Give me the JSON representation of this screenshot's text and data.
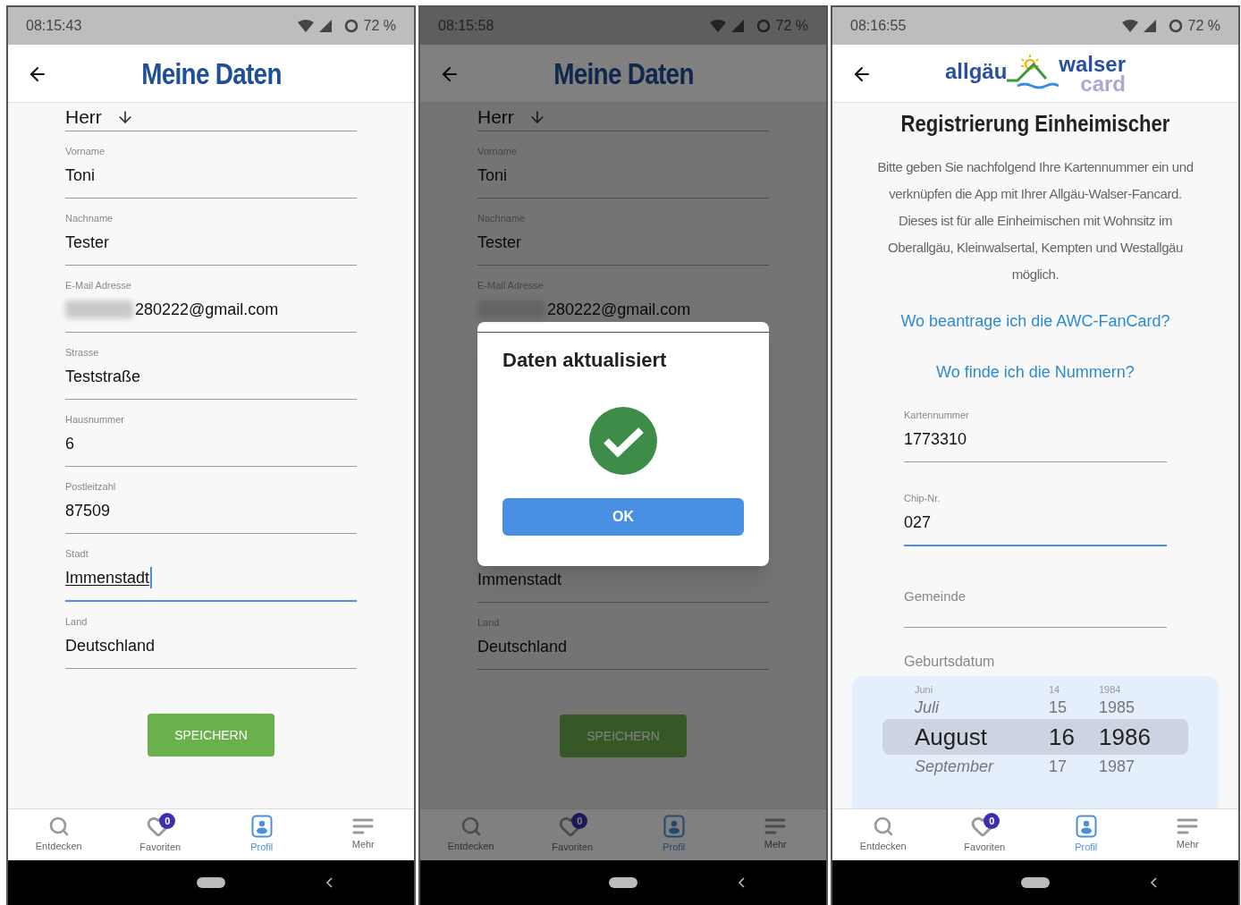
{
  "screens": [
    {
      "kind": "profile_form",
      "dimmed": false,
      "status_bar": {
        "time": "08:15:43",
        "battery": "72 %"
      },
      "header": {
        "kind": "title",
        "title": "Meine Daten"
      },
      "salutation": "Herr",
      "fields": [
        {
          "label": "Vorname",
          "value": "Toni",
          "focused": false,
          "redacted": false
        },
        {
          "label": "Nachname",
          "value": "Tester",
          "focused": false,
          "redacted": false
        },
        {
          "label": "E-Mail Adresse",
          "value": "280222@gmail.com",
          "focused": false,
          "redacted": true
        },
        {
          "label": "Strasse",
          "value": "Teststraße",
          "focused": false,
          "redacted": false
        },
        {
          "label": "Hausnummer",
          "value": "6",
          "focused": false,
          "redacted": false
        },
        {
          "label": "Postleitzahl",
          "value": "87509",
          "focused": false,
          "redacted": false
        },
        {
          "label": "Stadt",
          "value": "Immenstadt",
          "focused": true,
          "redacted": false
        },
        {
          "label": "Land",
          "value": "Deutschland",
          "focused": false,
          "redacted": false
        }
      ],
      "save_button": "SPEICHERN",
      "tabs": [
        {
          "kind": "search",
          "label": "Entdecken",
          "selected": false
        },
        {
          "kind": "heart",
          "label": "Favoriten",
          "badge": "0",
          "selected": false
        },
        {
          "kind": "profile",
          "label": "Profil",
          "selected": true
        },
        {
          "kind": "menu",
          "label": "Mehr",
          "selected": false
        }
      ]
    },
    {
      "kind": "profile_form",
      "dimmed": true,
      "status_bar": {
        "time": "08:15:58",
        "battery": "72 %"
      },
      "header": {
        "kind": "title",
        "title": "Meine Daten"
      },
      "salutation": "Herr",
      "fields": [
        {
          "kind": "field",
          "label": "Vorname",
          "value": "Toni",
          "focused": false,
          "redacted": false
        },
        {
          "kind": "field",
          "label": "Nachname",
          "value": "Tester",
          "focused": false,
          "redacted": false
        },
        {
          "kind": "field",
          "label": "E-Mail Adresse",
          "value": "280222@gmail.com",
          "focused": false,
          "redacted": true
        },
        {
          "kind": "dialog",
          "title": "Daten aktualisiert",
          "button": "OK"
        },
        {
          "kind": "field",
          "value": "Immenstadt",
          "focused": false,
          "redacted": false
        },
        {
          "kind": "field",
          "label": "Land",
          "value": "Deutschland",
          "focused": false,
          "redacted": false
        }
      ],
      "save_button": "SPEICHERN",
      "tabs": [
        {
          "kind": "search",
          "label": "Entdecken",
          "selected": false
        },
        {
          "kind": "heart",
          "label": "Favoriten",
          "badge": "0",
          "selected": false
        },
        {
          "kind": "profile",
          "label": "Profil",
          "selected": true
        },
        {
          "kind": "menu",
          "label": "Mehr",
          "selected": false
        }
      ]
    },
    {
      "kind": "registration",
      "dimmed": false,
      "status_bar": {
        "time": "08:16:55",
        "battery": "72 %"
      },
      "header": {
        "kind": "logo",
        "logo_words": [
          "allgäu",
          "walser",
          "card"
        ]
      },
      "heading": "Registrierung Einheimischer",
      "intro": "Bitte geben Sie nachfolgend Ihre Kartennummer ein und verknüpfen die App mit Ihrer Allgäu-Walser-Fancard. Dieses ist für alle Einheimischen mit Wohnsitz im Oberallgäu, Kleinwalsertal, Kempten und Westallgäu möglich.",
      "links": [
        "Wo beantrage ich die AWC-FanCard?",
        "Wo finde ich die Nummern?"
      ],
      "fields": [
        {
          "label": "Kartennummer",
          "value": "1773310",
          "focused": false,
          "redacted": false
        },
        {
          "label": "Chip-Nr.",
          "value": "027",
          "focused": true,
          "redacted": false
        },
        {
          "placeholder": "Gemeinde",
          "focused": false
        }
      ],
      "birthdate_label": "Geburtsdatum",
      "date_picker": [
        {
          "month": "Juni",
          "day": "14",
          "year": "1984",
          "selected": false
        },
        {
          "month": "Juli",
          "day": "15",
          "year": "1985",
          "selected": false
        },
        {
          "month": "August",
          "day": "16",
          "year": "1986",
          "selected": true
        },
        {
          "month": "September",
          "day": "17",
          "year": "1987",
          "selected": false
        }
      ],
      "tabs": [
        {
          "kind": "search",
          "label": "Entdecken",
          "selected": false
        },
        {
          "kind": "heart",
          "label": "Favoriten",
          "badge": "0",
          "selected": false
        },
        {
          "kind": "profile",
          "label": "Profil",
          "selected": true
        },
        {
          "kind": "menu",
          "label": "Mehr",
          "selected": false
        }
      ]
    }
  ]
}
